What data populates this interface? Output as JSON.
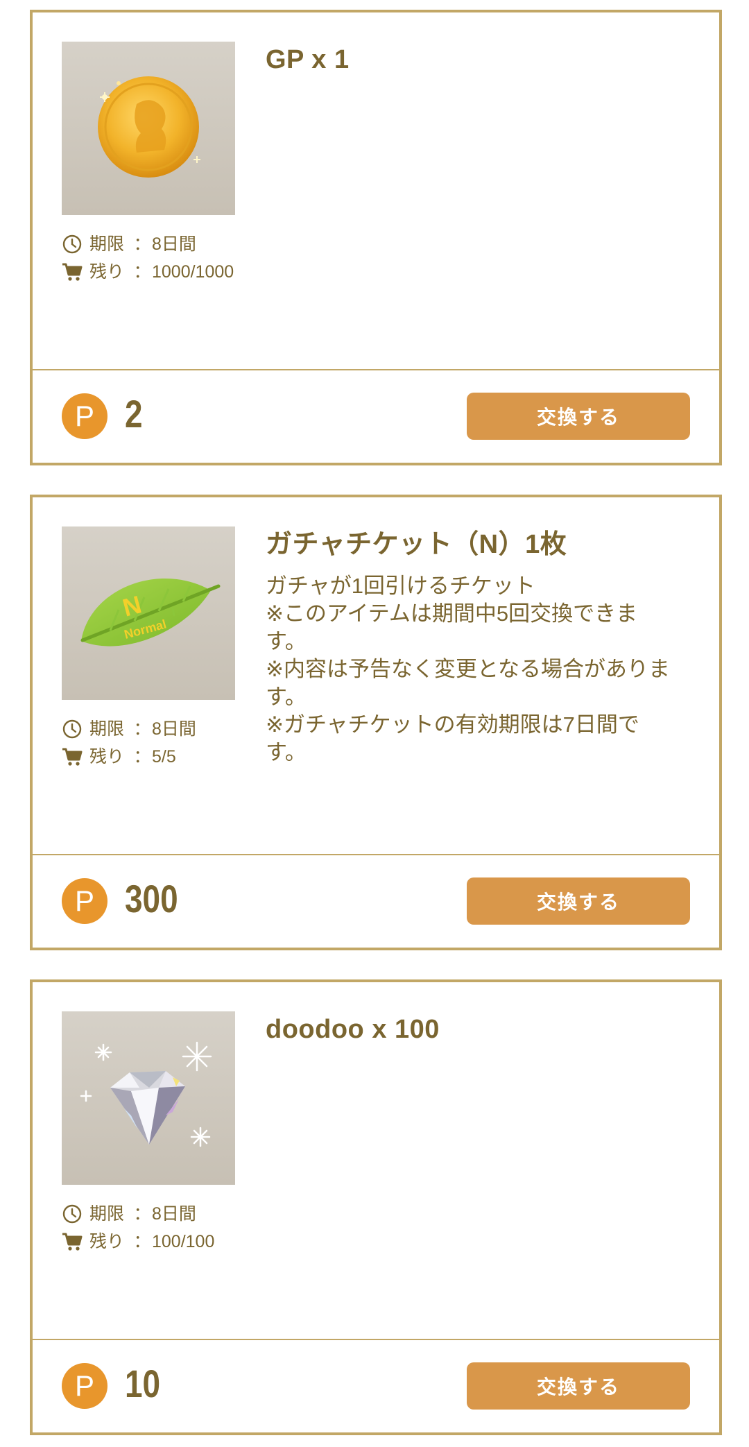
{
  "items": [
    {
      "title": "GP x 1",
      "description": "",
      "image": "gold-coin",
      "period_label": "期限",
      "period_value": "8日間",
      "remaining_label": "残り",
      "remaining_value": "1000/1000",
      "separator": "：",
      "points_icon": "P",
      "price": "2",
      "button_label": "交換する"
    },
    {
      "title": "ガチャチケット（N）1枚",
      "description": "ガチャが1回引けるチケット\n※このアイテムは期間中5回交換できま\nす。\n※内容は予告なく変更となる場合がありま\nす。\n※ガチャチケットの有効期限は7日間で\nす。",
      "image": "normal-leaf-ticket",
      "image_text": "Normal",
      "image_letter": "N",
      "period_label": "期限",
      "period_value": "8日間",
      "remaining_label": "残り",
      "remaining_value": "5/5",
      "separator": "：",
      "points_icon": "P",
      "price": "300",
      "button_label": "交換する"
    },
    {
      "title": "doodoo x 100",
      "description": "",
      "image": "diamond",
      "period_label": "期限",
      "period_value": "8日間",
      "remaining_label": "残り",
      "remaining_value": "100/100",
      "separator": "：",
      "points_icon": "P",
      "price": "10",
      "button_label": "交換する"
    }
  ],
  "colors": {
    "border": "#c2a766",
    "text": "#7a6530",
    "badge": "#e8962c",
    "button": "#d9974a"
  }
}
